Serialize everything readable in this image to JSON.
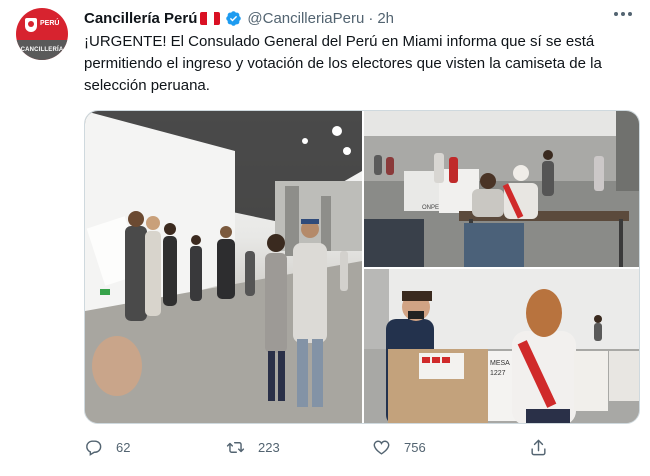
{
  "tweet": {
    "author_name": "Cancillería Perú",
    "handle": "@CancilleriaPeru",
    "separator": "·",
    "time": "2h",
    "text": "¡URGENTE! El Consulado General del Perú en Miami informa que sí se está permitiendo el ingreso y votación de los electores que visten la camiseta de la selección peruana.",
    "avatar": {
      "top_text": "PERÚ",
      "band_text": "CANCILLERÍA"
    },
    "flag_colors": [
      "#d91023",
      "#ffffff",
      "#d91023"
    ],
    "verified_color": "#1d9bf0"
  },
  "media": {
    "photos": [
      {
        "name": "voters-queue-photo"
      },
      {
        "name": "polling-table-photo"
      },
      {
        "name": "voting-booth-photo"
      }
    ],
    "scene_text": {
      "booth_label": "ONPE",
      "mesa_label": "MESA",
      "mesa_number": "1227"
    }
  },
  "actions": {
    "replies": "62",
    "retweets": "223",
    "likes": "756"
  },
  "colors": {
    "text": "#0f1419",
    "secondary": "#536471",
    "border": "#cfd9de"
  }
}
